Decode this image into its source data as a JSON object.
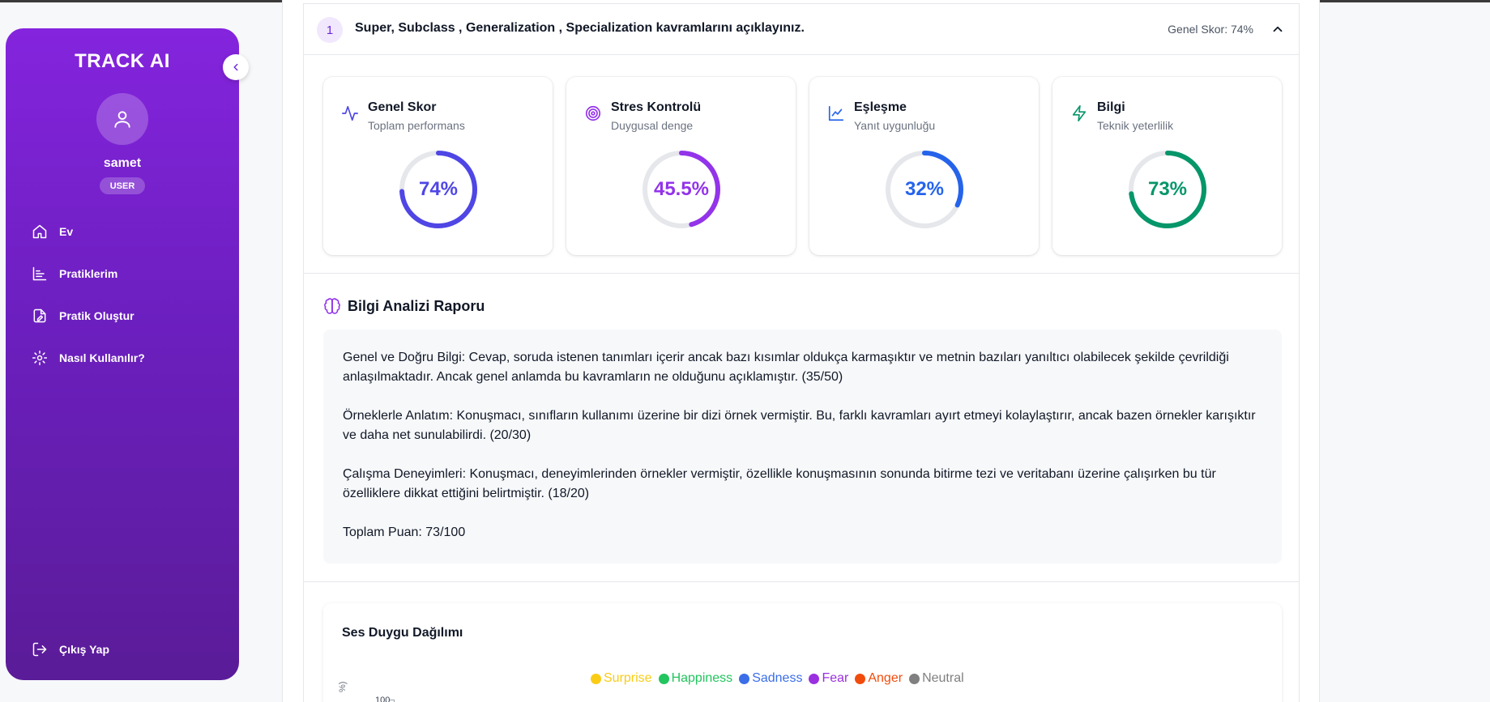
{
  "sidebar": {
    "brand": "TRACK AI",
    "username": "samet",
    "role": "USER",
    "nav": [
      {
        "label": "Ev",
        "icon": "home-icon"
      },
      {
        "label": "Pratiklerim",
        "icon": "chart-bars-icon"
      },
      {
        "label": "Pratik Oluştur",
        "icon": "file-edit-icon"
      },
      {
        "label": "Nasıl Kullanılır?",
        "icon": "gear-icon"
      }
    ],
    "logout": "Çıkış Yap"
  },
  "question": {
    "number": "1",
    "title": "Super, Subclass , Generalization , Specialization kavramlarını açıklayınız.",
    "score_label": "Genel Skor: 74%"
  },
  "metrics": [
    {
      "title": "Genel Skor",
      "subtitle": "Toplam performans",
      "value_text": "74%",
      "value": 74,
      "color": "#4f46e5"
    },
    {
      "title": "Stres Kontrolü",
      "subtitle": "Duygusal denge",
      "value_text": "45.5%",
      "value": 45.5,
      "color": "#9333ea"
    },
    {
      "title": "Eşleşme",
      "subtitle": "Yanıt uygunluğu",
      "value_text": "32%",
      "value": 32,
      "color": "#2563eb"
    },
    {
      "title": "Bilgi",
      "subtitle": "Teknik yeterlilik",
      "value_text": "73%",
      "value": 73,
      "color": "#059669"
    }
  ],
  "report": {
    "title": "Bilgi Analizi Raporu",
    "paragraphs": [
      "Genel ve Doğru Bilgi: Cevap, soruda istenen tanımları içerir ancak bazı kısımlar oldukça karmaşıktır ve metnin bazıları yanıltıcı olabilecek şekilde çevrildiği anlaşılmaktadır. Ancak genel anlamda bu kavramların ne olduğunu açıklamıştır. (35/50)",
      "Örneklerle Anlatım: Konuşmacı, sınıfların kullanımı üzerine bir dizi örnek vermiştir. Bu, farklı kavramları ayırt etmeyi kolaylaştırır, ancak bazen örnekler karışıktır ve daha net sunulabilirdi. (20/30)",
      "Çalışma Deneyimleri: Konuşmacı, deneyimlerinden örnekler vermiştir, özellikle konuşmasının sonunda bitirme tezi ve veritabanı üzerine çalışırken bu tür özelliklere dikkat ettiğini belirtmiştir. (18/20)",
      "Toplam Puan: 73/100"
    ]
  },
  "chart_data": {
    "type": "bar",
    "title": "Ses Duygu Dağılımı",
    "ylabel": "%)",
    "ytick_top": "100",
    "legend": [
      {
        "name": "Surprise",
        "color": "#facc15"
      },
      {
        "name": "Happiness",
        "color": "#22c55e"
      },
      {
        "name": "Sadness",
        "color": "#3b6ee8"
      },
      {
        "name": "Fear",
        "color": "#9b30e0"
      },
      {
        "name": "Anger",
        "color": "#f24c0c"
      },
      {
        "name": "Neutral",
        "color": "#808080"
      }
    ]
  }
}
